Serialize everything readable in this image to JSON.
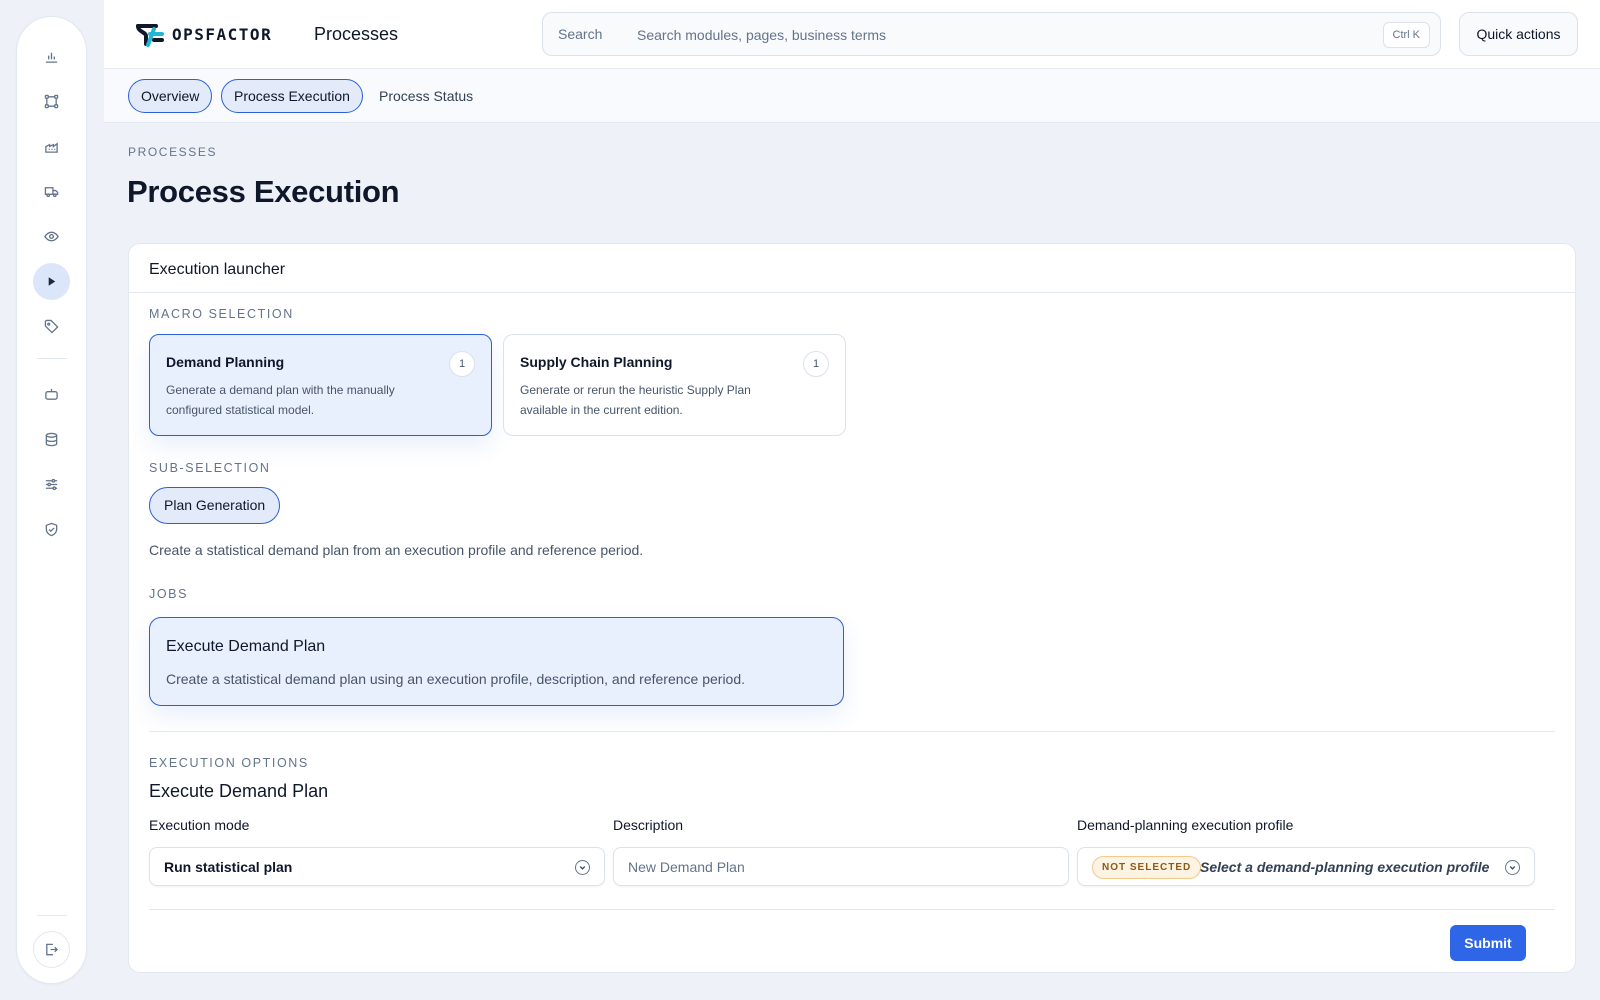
{
  "brand": {
    "name": "OPSFACTOR",
    "accent": "#2f66e8",
    "logo_mark_color": "#22b7d6"
  },
  "header": {
    "title": "Processes",
    "search": {
      "label": "Search",
      "placeholder": "Search modules, pages, business terms",
      "value": "",
      "shortcut": "Ctrl K"
    },
    "quick_actions": "Quick actions"
  },
  "sidebar": {
    "items": [
      {
        "icon": "bar-chart-icon",
        "active": false
      },
      {
        "icon": "workflow-icon",
        "active": false
      },
      {
        "icon": "factory-icon",
        "active": false
      },
      {
        "icon": "truck-icon",
        "active": false
      },
      {
        "icon": "eye-icon",
        "active": false
      },
      {
        "icon": "play-icon",
        "active": true
      },
      {
        "icon": "tag-icon",
        "active": false
      },
      {
        "icon": "bot-icon",
        "active": false
      },
      {
        "icon": "database-icon",
        "active": false
      },
      {
        "icon": "sliders-icon",
        "active": false
      },
      {
        "icon": "shield-check-icon",
        "active": false
      }
    ],
    "footer_icon": "logout-icon"
  },
  "tabs": [
    {
      "label": "Overview",
      "style": "pill"
    },
    {
      "label": "Process Execution",
      "style": "pill",
      "active": true
    },
    {
      "label": "Process Status",
      "style": "plain"
    }
  ],
  "page": {
    "eyebrow": "PROCESSES",
    "title": "Process Execution"
  },
  "launcher": {
    "title": "Execution launcher",
    "macro_label": "MACRO SELECTION",
    "macros": [
      {
        "title": "Demand Planning",
        "description": "Generate a demand plan with the manually configured statistical model.",
        "count": "1",
        "selected": true
      },
      {
        "title": "Supply Chain Planning",
        "description": "Generate or rerun the heuristic Supply Plan available in the current edition.",
        "count": "1",
        "selected": false
      }
    ],
    "sub_label": "SUB-SELECTION",
    "sub_option": "Plan Generation",
    "sub_description": "Create a statistical demand plan from an execution profile and reference period.",
    "jobs_label": "JOBS",
    "job": {
      "title": "Execute Demand Plan",
      "description": "Create a statistical demand plan using an execution profile, description, and reference period."
    }
  },
  "options": {
    "label": "EXECUTION OPTIONS",
    "title": "Execute Demand Plan",
    "mode": {
      "label": "Execution mode",
      "value": "Run statistical plan"
    },
    "description": {
      "label": "Description",
      "placeholder": "New Demand Plan",
      "value": ""
    },
    "profile": {
      "label": "Demand-planning execution profile",
      "badge": "NOT SELECTED",
      "placeholder": "Select a demand-planning execution profile"
    },
    "submit": "Submit"
  }
}
